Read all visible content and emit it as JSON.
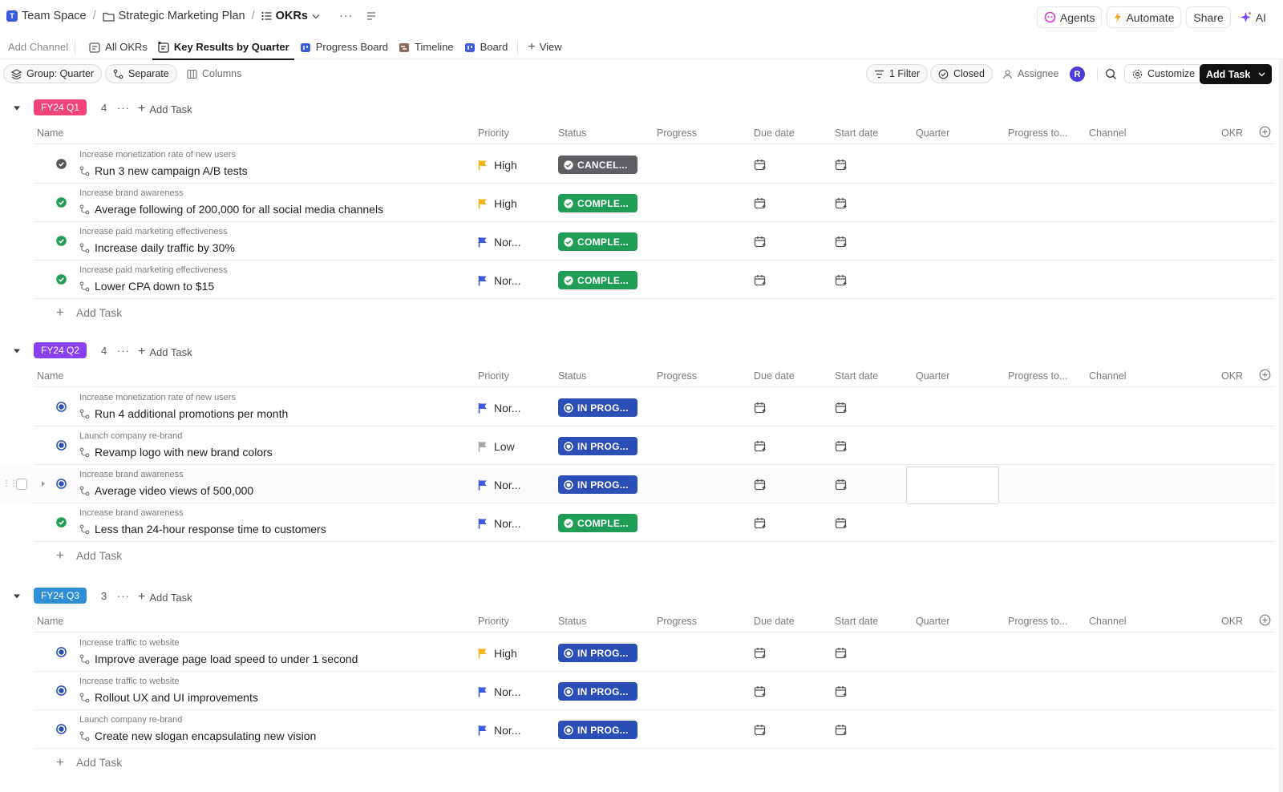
{
  "breadcrumbs": [
    {
      "label": "Team Space",
      "icon": "team-space-icon"
    },
    {
      "label": "Strategic Marketing Plan",
      "icon": "folder-icon"
    },
    {
      "label": "OKRs",
      "icon": "list-icon"
    }
  ],
  "top_actions": {
    "agents": "Agents",
    "automate": "Automate",
    "share": "Share",
    "ai": "AI"
  },
  "views": {
    "add_channel": "Add Channel",
    "tabs": [
      "All OKRs",
      "Key Results by Quarter",
      "Progress Board",
      "Timeline",
      "Board"
    ],
    "active_tab": "Key Results by Quarter",
    "add_view": "View"
  },
  "toolbar": {
    "group": "Group: Quarter",
    "separate": "Separate",
    "columns": "Columns",
    "filter": "1 Filter",
    "closed": "Closed",
    "assignee": "Assignee",
    "avatar_initial": "R",
    "customize": "Customize",
    "add_task": "Add Task"
  },
  "columns": [
    "Name",
    "Priority",
    "Status",
    "Progress",
    "Due date",
    "Start date",
    "Quarter",
    "Progress to...",
    "Channel",
    "OKR"
  ],
  "add_task_label": "Add Task",
  "groups": [
    {
      "name": "FY24 Q1",
      "color": "#f0437a",
      "count": "4",
      "tasks": [
        {
          "okr": "Increase monetization rate of new users",
          "title": "Run 3 new campaign A/B tests",
          "priority": "High",
          "priority_color": "#f6b820",
          "status": "CANCEL...",
          "status_kind": "cancel"
        },
        {
          "okr": "Increase brand awareness",
          "title": "Average following of 200,000 for all social media channels",
          "priority": "High",
          "priority_color": "#f6b820",
          "status": "COMPLE...",
          "status_kind": "complete"
        },
        {
          "okr": "Increase paid marketing effectiveness",
          "title": "Increase daily traffic by 30%",
          "priority": "Nor...",
          "priority_color": "#3d5ad8",
          "status": "COMPLE...",
          "status_kind": "complete"
        },
        {
          "okr": "Increase paid marketing effectiveness",
          "title": "Lower CPA down to $15",
          "priority": "Nor...",
          "priority_color": "#3d5ad8",
          "status": "COMPLE...",
          "status_kind": "complete"
        }
      ]
    },
    {
      "name": "FY24 Q2",
      "color": "#8a3ff0",
      "count": "4",
      "tasks": [
        {
          "okr": "Increase monetization rate of new users",
          "title": "Run 4 additional promotions per month",
          "priority": "Nor...",
          "priority_color": "#3d5ad8",
          "status": "IN PROG...",
          "status_kind": "progress"
        },
        {
          "okr": "Launch company re-brand",
          "title": "Revamp logo with new brand colors",
          "priority": "Low",
          "priority_color": "#a8a8ad",
          "status": "IN PROG...",
          "status_kind": "progress"
        },
        {
          "okr": "Increase brand awareness",
          "title": "Average video views of 500,000",
          "priority": "Nor...",
          "priority_color": "#3d5ad8",
          "status": "IN PROG...",
          "status_kind": "progress",
          "hover": true
        },
        {
          "okr": "Increase brand awareness",
          "title": "Less than 24-hour response time to customers",
          "priority": "Nor...",
          "priority_color": "#3d5ad8",
          "status": "COMPLE...",
          "status_kind": "complete"
        }
      ]
    },
    {
      "name": "FY24 Q3",
      "color": "#2f8fd6",
      "count": "3",
      "tasks": [
        {
          "okr": "Increase traffic to website",
          "title": "Improve average page load speed to under 1 second",
          "priority": "High",
          "priority_color": "#f6b820",
          "status": "IN PROG...",
          "status_kind": "progress"
        },
        {
          "okr": "Increase traffic to website",
          "title": "Rollout UX and UI improvements",
          "priority": "Nor...",
          "priority_color": "#3d5ad8",
          "status": "IN PROG...",
          "status_kind": "progress"
        },
        {
          "okr": "Launch company re-brand",
          "title": "Create new slogan encapsulating new vision",
          "priority": "Nor...",
          "priority_color": "#3d5ad8",
          "status": "IN PROG...",
          "status_kind": "progress"
        }
      ]
    }
  ]
}
